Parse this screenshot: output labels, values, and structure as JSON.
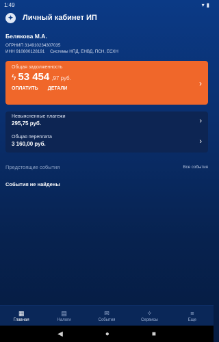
{
  "status": {
    "time": "1:49",
    "battery_icon": "battery-icon",
    "wifi_icon": "wifi-icon"
  },
  "app": {
    "title": "Личный кабинет ИП"
  },
  "user": {
    "name": "Белякова М.А.",
    "ogrnip": "ОГРНИП 314910234307035",
    "inn": "ИНН 910800128191",
    "systems": "Системы НПД, ЕНВД, ПСН, ЕСХН"
  },
  "debt": {
    "label": "Общая задолженность",
    "amount_main": "53 454",
    "amount_rest": ",97 руб.",
    "pay_label": "ОПЛАТИТЬ",
    "details_label": "ДЕТАЛИ"
  },
  "payments": [
    {
      "label": "Невыясненные платежи",
      "value": "295,75 руб."
    },
    {
      "label": "Общая переплата",
      "value": "3 160,00 руб."
    }
  ],
  "events": {
    "title": "Предстоящие события",
    "all_label": "Все события",
    "empty_label": "События не найдены"
  },
  "nav": [
    {
      "label": "Главная",
      "icon": "home-icon",
      "active": true
    },
    {
      "label": "Налоги",
      "icon": "taxes-icon",
      "active": false
    },
    {
      "label": "События",
      "icon": "mail-icon",
      "active": false
    },
    {
      "label": "Сервисы",
      "icon": "services-icon",
      "active": false
    },
    {
      "label": "Еще",
      "icon": "menu-icon",
      "active": false
    }
  ],
  "colors": {
    "accent": "#f0672a",
    "background": "#0a2f6e",
    "card": "#0d2553"
  }
}
